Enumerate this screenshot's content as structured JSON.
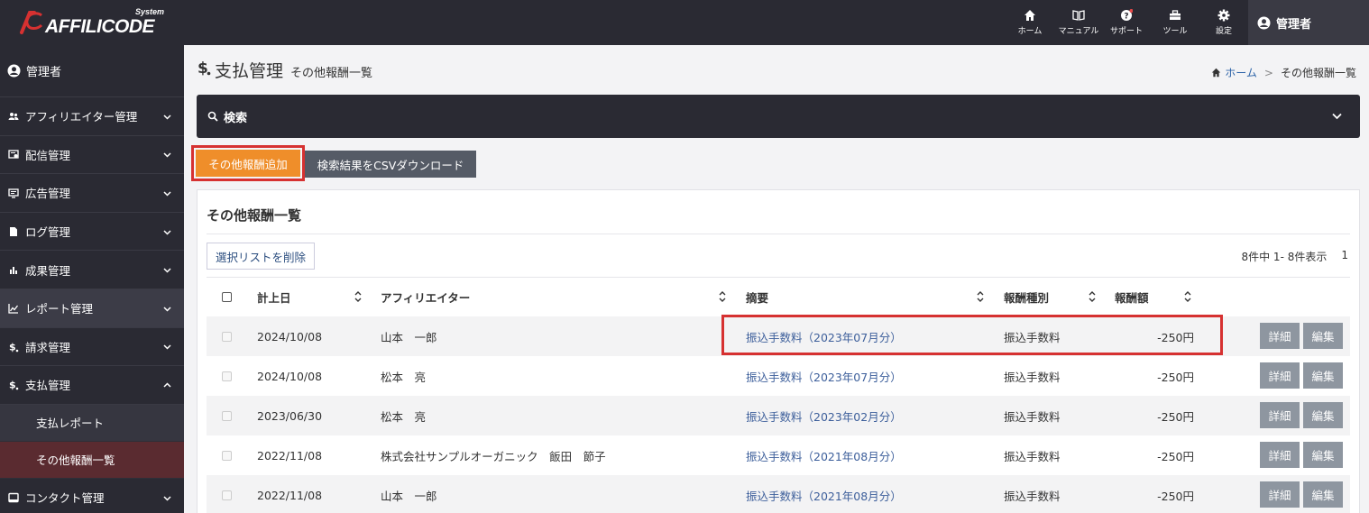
{
  "app": {
    "logo_text": "AFFILICODE",
    "logo_suffix": "System",
    "brand_color": "#d63131"
  },
  "topnav": [
    {
      "label": "ホーム",
      "icon": "home-icon"
    },
    {
      "label": "マニュアル",
      "icon": "book-icon"
    },
    {
      "label": "サポート",
      "icon": "help-icon"
    },
    {
      "label": "ツール",
      "icon": "toolbox-icon"
    },
    {
      "label": "設定",
      "icon": "gear-icon"
    }
  ],
  "user": {
    "name": "管理者"
  },
  "sidebar": {
    "user_label": "管理者",
    "items": [
      {
        "label": "アフィリエイター管理",
        "icon": "people-icon"
      },
      {
        "label": "配信管理",
        "icon": "delivery-icon"
      },
      {
        "label": "広告管理",
        "icon": "monitor-icon"
      },
      {
        "label": "ログ管理",
        "icon": "file-icon"
      },
      {
        "label": "成果管理",
        "icon": "bar-chart-icon"
      },
      {
        "label": "レポート管理",
        "icon": "line-chart-icon"
      },
      {
        "label": "請求管理",
        "icon": "dollar-icon"
      },
      {
        "label": "支払管理",
        "icon": "dollar-icon"
      }
    ],
    "subitems": [
      {
        "label": "支払レポート"
      },
      {
        "label": "その他報酬一覧"
      }
    ],
    "last_item": {
      "label": "コンタクト管理",
      "icon": "contact-icon"
    }
  },
  "page": {
    "title": "支払管理",
    "subtitle": "その他報酬一覧",
    "breadcrumb_home": "ホーム",
    "breadcrumb_sep": ">",
    "breadcrumb_current": "その他報酬一覧"
  },
  "search": {
    "label": "検索"
  },
  "actions": {
    "add_label": "その他報酬追加",
    "csv_label": "検索結果をCSVダウンロード",
    "add_color": "#ef8e2a"
  },
  "panel": {
    "title": "その他報酬一覧",
    "delete_label": "選択リストを削除",
    "count_text": "8件中 1- 8件表示",
    "page_number": "1"
  },
  "table": {
    "headers": {
      "date": "計上日",
      "affiliate": "アフィリエイター",
      "summary": "摘要",
      "type": "報酬種別",
      "amount": "報酬額"
    },
    "detail_label": "詳細",
    "edit_label": "編集",
    "rows": [
      {
        "date": "2024/10/08",
        "affiliate": "山本　一郎",
        "summary": "振込手数料（2023年07月分）",
        "type": "振込手数料",
        "amount": "-250円"
      },
      {
        "date": "2024/10/08",
        "affiliate": "松本　亮",
        "summary": "振込手数料（2023年07月分）",
        "type": "振込手数料",
        "amount": "-250円"
      },
      {
        "date": "2023/06/30",
        "affiliate": "松本　亮",
        "summary": "振込手数料（2023年02月分）",
        "type": "振込手数料",
        "amount": "-250円"
      },
      {
        "date": "2022/11/08",
        "affiliate": "株式会社サンプルオーガニック　飯田　節子",
        "summary": "振込手数料（2021年08月分）",
        "type": "振込手数料",
        "amount": "-250円"
      },
      {
        "date": "2022/11/08",
        "affiliate": "山本　一郎",
        "summary": "振込手数料（2021年08月分）",
        "type": "振込手数料",
        "amount": "-250円"
      }
    ]
  }
}
